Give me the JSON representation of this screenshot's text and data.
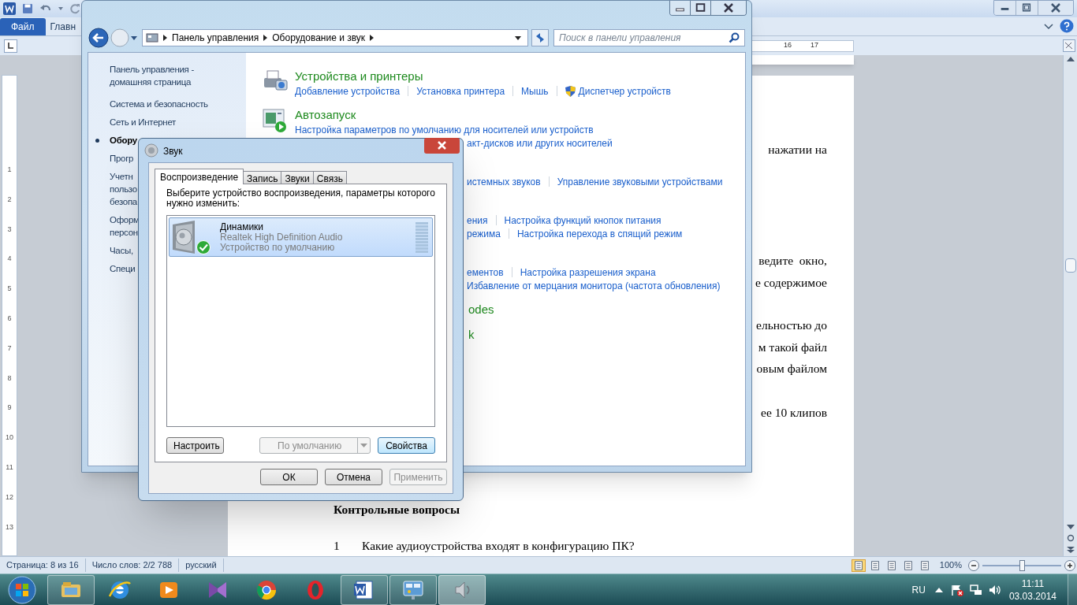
{
  "word": {
    "ribbon_tabs": [
      {
        "label": "Файл",
        "selected": true
      },
      {
        "label": "Главн",
        "selected": false
      }
    ],
    "ruler": {
      "horizontal": [
        "16",
        "17"
      ],
      "vertical": [
        "1",
        "2",
        "3",
        "4",
        "5",
        "6",
        "7",
        "8",
        "9",
        "10",
        "11",
        "12",
        "13"
      ]
    },
    "document": {
      "fragments": [
        [
          "нажатии на"
        ],
        [
          "ведите  окно,",
          "е содержимое"
        ],
        [
          "ельностью до",
          "м такой файл",
          "овым файлом"
        ],
        [
          "ее 10 клипов"
        ]
      ],
      "heading": "Контрольные вопросы",
      "questions": [
        {
          "number": "1",
          "text": "Какие аудиоустройства входят в конфигурацию ПК?"
        }
      ]
    },
    "status_bar": {
      "items": [
        "Страница: 8 из 16",
        "Число слов: 2/2 788",
        "русский"
      ],
      "views": [
        {
          "selected": true
        },
        {
          "selected": false
        },
        {
          "selected": false
        },
        {
          "selected": false
        },
        {
          "selected": false
        }
      ],
      "zoom": {
        "label": "100%",
        "level": 0.5
      }
    }
  },
  "control_panel": {
    "breadcrumb": [
      "Панель управления",
      "Оборудование и звук"
    ],
    "search": {
      "placeholder": "Поиск в панели управления"
    },
    "sidebar": [
      {
        "lines": [
          "Панель управления -",
          "домашняя страница"
        ],
        "selected": false
      },
      {
        "lines": [
          "Система и безопасность"
        ],
        "selected": false
      },
      {
        "lines": [
          "Сеть и Интернет"
        ],
        "selected": false
      },
      {
        "lines": [
          "Обору"
        ],
        "selected": true
      },
      {
        "lines": [
          "Прогр"
        ],
        "selected": false
      },
      {
        "lines": [
          "Учетн",
          "пользо",
          "безопа"
        ],
        "selected": false
      },
      {
        "lines": [
          "Оформ",
          "персон"
        ],
        "selected": false
      },
      {
        "lines": [
          "Часы, "
        ],
        "selected": false
      },
      {
        "lines": [
          "Специ"
        ],
        "selected": false
      }
    ],
    "sections": [
      {
        "title": "Устройства и принтеры",
        "title_clipped": false,
        "rows": [
          {
            "clipped": false,
            "links": [
              {
                "text": "Добавление устройства"
              },
              {
                "text": "Установка принтера"
              },
              {
                "text": "Мышь"
              },
              {
                "text": "Диспетчер устройств",
                "kind": "shield-link"
              }
            ]
          }
        ]
      },
      {
        "title": "Автозапуск",
        "title_clipped": false,
        "rows": [
          {
            "clipped": false,
            "links": [
              {
                "text": "Настройка параметров по умолчанию для носителей или устройств"
              }
            ]
          },
          {
            "clipped": true,
            "links": [
              {
                "text": "акт-дисков или других носителей"
              }
            ]
          }
        ]
      },
      {
        "rows": [
          {
            "clipped": true,
            "links": [
              {
                "text": "истемных звуков"
              },
              {
                "text": "Управление звуковыми устройствами"
              }
            ]
          }
        ]
      },
      {
        "rows": [
          {
            "clipped": true,
            "links": [
              {
                "text": "ения"
              },
              {
                "text": "Настройка функций кнопок питания"
              }
            ]
          },
          {
            "clipped": true,
            "links": [
              {
                "text": "режима"
              },
              {
                "text": "Настройка перехода в спящий режим"
              }
            ]
          }
        ]
      },
      {
        "rows": [
          {
            "clipped": true,
            "links": [
              {
                "text": "ементов"
              },
              {
                "text": "Настройка разрешения экрана"
              }
            ]
          },
          {
            "clipped": true,
            "links": [
              {
                "text": "Избавление от мерцания монитора (частота обновления)"
              }
            ]
          }
        ]
      },
      {
        "title": "odes",
        "title_clipped": true
      },
      {
        "title": "k",
        "title_clipped": true
      }
    ]
  },
  "sound_dialog": {
    "title": "Звук",
    "tabs": [
      {
        "label": "Воспроизведение",
        "selected": true
      },
      {
        "label": "Запись",
        "selected": false
      },
      {
        "label": "Звуки",
        "selected": false
      },
      {
        "label": "Связь",
        "selected": false
      }
    ],
    "instruction": "Выберите устройство воспроизведения, параметры которого нужно изменить:",
    "devices": [
      {
        "name": "Динамики",
        "driver": "Realtek High Definition Audio",
        "status": "Устройство по умолчанию",
        "selected": true,
        "default": true
      }
    ],
    "panel_buttons": [
      {
        "kind": "button",
        "label": "Настроить",
        "disabled": false,
        "focused": false
      },
      {
        "kind": "split",
        "label": "По умолчанию",
        "disabled": true,
        "focused": false
      },
      {
        "kind": "button",
        "label": "Свойства",
        "disabled": false,
        "focused": true
      }
    ],
    "buttons": [
      {
        "label": "ОК",
        "disabled": false
      },
      {
        "label": "Отмена",
        "disabled": false
      },
      {
        "label": "Применить",
        "disabled": true
      }
    ]
  },
  "taskbar": {
    "apps": [
      {
        "kind": "explorer",
        "running": true,
        "selected": false
      },
      {
        "kind": "browser-e",
        "running": false,
        "selected": false
      },
      {
        "kind": "player",
        "running": false,
        "selected": false
      },
      {
        "kind": "bow",
        "running": false,
        "selected": false
      },
      {
        "kind": "chrome",
        "running": false,
        "selected": false
      },
      {
        "kind": "opera",
        "running": false,
        "selected": false
      },
      {
        "kind": "word",
        "running": true,
        "selected": false
      },
      {
        "kind": "panel",
        "running": true,
        "selected": false
      },
      {
        "kind": "speaker",
        "running": true,
        "selected": true
      }
    ],
    "language": "RU",
    "time": "11:11",
    "date": "03.03.2014"
  }
}
